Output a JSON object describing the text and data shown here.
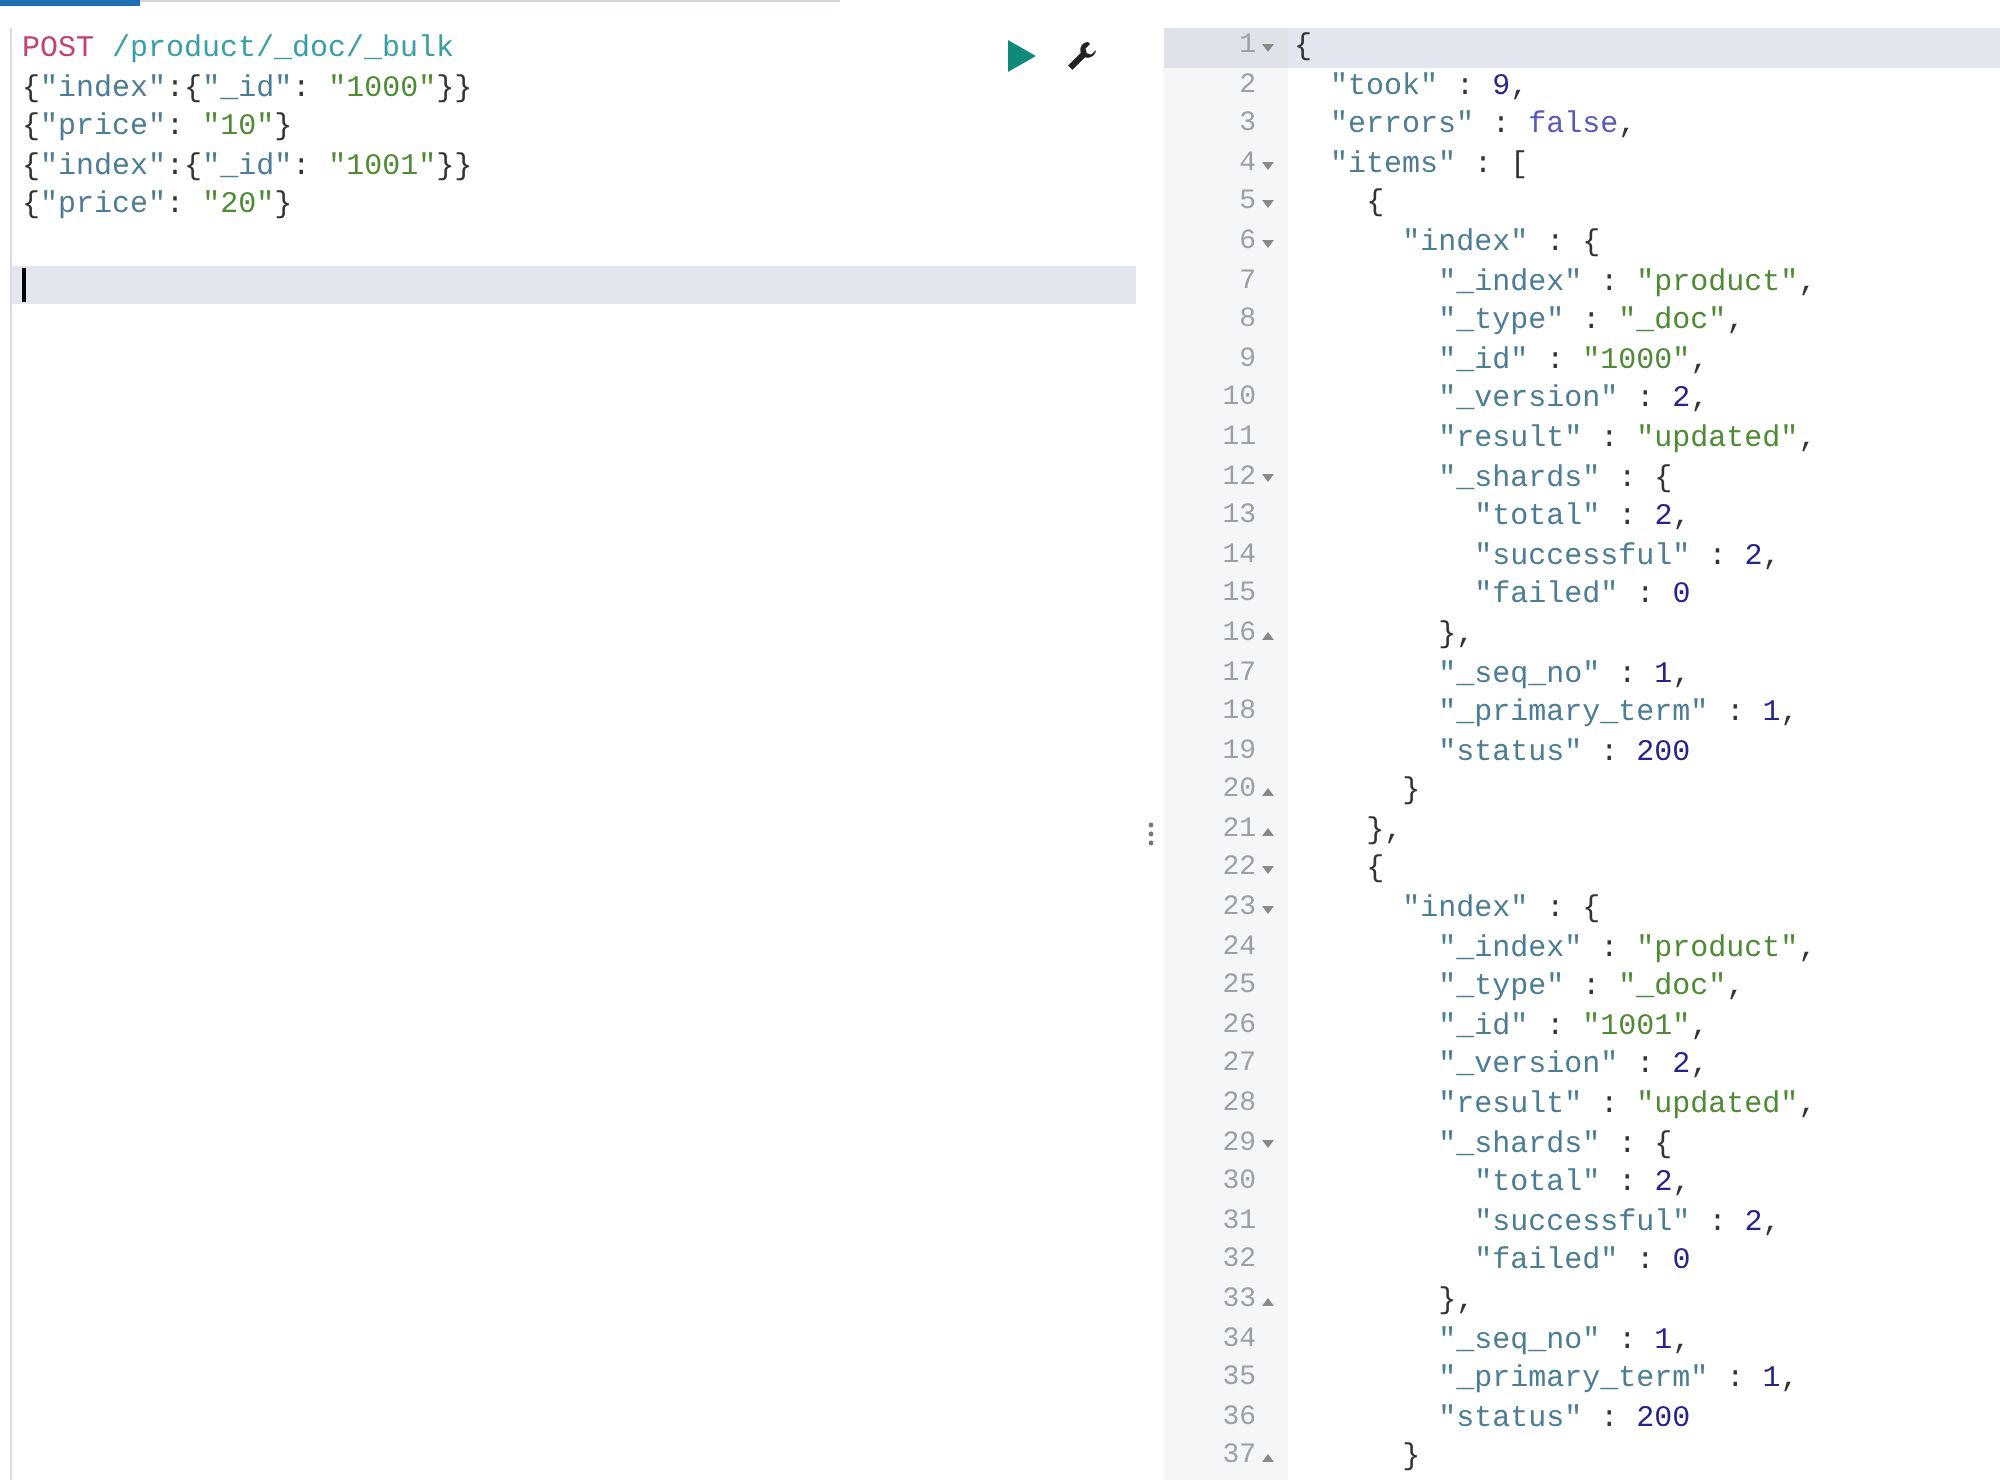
{
  "request": {
    "method": "POST",
    "path": "/product/_doc/_bulk",
    "body": [
      "{\"index\":{\"_id\": \"1000\"}}",
      "{\"price\": \"10\"}",
      "{\"index\":{\"_id\": \"1001\"}}",
      "{\"price\": \"20\"}"
    ],
    "cursor_line_highlighted": true
  },
  "response": {
    "lines": [
      {
        "number": "1",
        "fold_start": true,
        "fold_end": false,
        "active": true,
        "text": "{"
      },
      {
        "number": "2",
        "fold_start": false,
        "fold_end": false,
        "active": false,
        "text": "  \"took\" : 9,"
      },
      {
        "number": "3",
        "fold_start": false,
        "fold_end": false,
        "active": false,
        "text": "  \"errors\" : false,"
      },
      {
        "number": "4",
        "fold_start": true,
        "fold_end": false,
        "active": false,
        "text": "  \"items\" : ["
      },
      {
        "number": "5",
        "fold_start": true,
        "fold_end": false,
        "active": false,
        "text": "    {"
      },
      {
        "number": "6",
        "fold_start": true,
        "fold_end": false,
        "active": false,
        "text": "      \"index\" : {"
      },
      {
        "number": "7",
        "fold_start": false,
        "fold_end": false,
        "active": false,
        "text": "        \"_index\" : \"product\","
      },
      {
        "number": "8",
        "fold_start": false,
        "fold_end": false,
        "active": false,
        "text": "        \"_type\" : \"_doc\","
      },
      {
        "number": "9",
        "fold_start": false,
        "fold_end": false,
        "active": false,
        "text": "        \"_id\" : \"1000\","
      },
      {
        "number": "10",
        "fold_start": false,
        "fold_end": false,
        "active": false,
        "text": "        \"_version\" : 2,"
      },
      {
        "number": "11",
        "fold_start": false,
        "fold_end": false,
        "active": false,
        "text": "        \"result\" : \"updated\","
      },
      {
        "number": "12",
        "fold_start": true,
        "fold_end": false,
        "active": false,
        "text": "        \"_shards\" : {"
      },
      {
        "number": "13",
        "fold_start": false,
        "fold_end": false,
        "active": false,
        "text": "          \"total\" : 2,"
      },
      {
        "number": "14",
        "fold_start": false,
        "fold_end": false,
        "active": false,
        "text": "          \"successful\" : 2,"
      },
      {
        "number": "15",
        "fold_start": false,
        "fold_end": false,
        "active": false,
        "text": "          \"failed\" : 0"
      },
      {
        "number": "16",
        "fold_start": false,
        "fold_end": true,
        "active": false,
        "text": "        },"
      },
      {
        "number": "17",
        "fold_start": false,
        "fold_end": false,
        "active": false,
        "text": "        \"_seq_no\" : 1,"
      },
      {
        "number": "18",
        "fold_start": false,
        "fold_end": false,
        "active": false,
        "text": "        \"_primary_term\" : 1,"
      },
      {
        "number": "19",
        "fold_start": false,
        "fold_end": false,
        "active": false,
        "text": "        \"status\" : 200"
      },
      {
        "number": "20",
        "fold_start": false,
        "fold_end": true,
        "active": false,
        "text": "      }"
      },
      {
        "number": "21",
        "fold_start": false,
        "fold_end": true,
        "active": false,
        "text": "    },"
      },
      {
        "number": "22",
        "fold_start": true,
        "fold_end": false,
        "active": false,
        "text": "    {"
      },
      {
        "number": "23",
        "fold_start": true,
        "fold_end": false,
        "active": false,
        "text": "      \"index\" : {"
      },
      {
        "number": "24",
        "fold_start": false,
        "fold_end": false,
        "active": false,
        "text": "        \"_index\" : \"product\","
      },
      {
        "number": "25",
        "fold_start": false,
        "fold_end": false,
        "active": false,
        "text": "        \"_type\" : \"_doc\","
      },
      {
        "number": "26",
        "fold_start": false,
        "fold_end": false,
        "active": false,
        "text": "        \"_id\" : \"1001\","
      },
      {
        "number": "27",
        "fold_start": false,
        "fold_end": false,
        "active": false,
        "text": "        \"_version\" : 2,"
      },
      {
        "number": "28",
        "fold_start": false,
        "fold_end": false,
        "active": false,
        "text": "        \"result\" : \"updated\","
      },
      {
        "number": "29",
        "fold_start": true,
        "fold_end": false,
        "active": false,
        "text": "        \"_shards\" : {"
      },
      {
        "number": "30",
        "fold_start": false,
        "fold_end": false,
        "active": false,
        "text": "          \"total\" : 2,"
      },
      {
        "number": "31",
        "fold_start": false,
        "fold_end": false,
        "active": false,
        "text": "          \"successful\" : 2,"
      },
      {
        "number": "32",
        "fold_start": false,
        "fold_end": false,
        "active": false,
        "text": "          \"failed\" : 0"
      },
      {
        "number": "33",
        "fold_start": false,
        "fold_end": true,
        "active": false,
        "text": "        },"
      },
      {
        "number": "34",
        "fold_start": false,
        "fold_end": false,
        "active": false,
        "text": "        \"_seq_no\" : 1,"
      },
      {
        "number": "35",
        "fold_start": false,
        "fold_end": false,
        "active": false,
        "text": "        \"_primary_term\" : 1,"
      },
      {
        "number": "36",
        "fold_start": false,
        "fold_end": false,
        "active": false,
        "text": "        \"status\" : 200"
      },
      {
        "number": "37",
        "fold_start": false,
        "fold_end": true,
        "active": false,
        "text": "      }"
      }
    ]
  }
}
